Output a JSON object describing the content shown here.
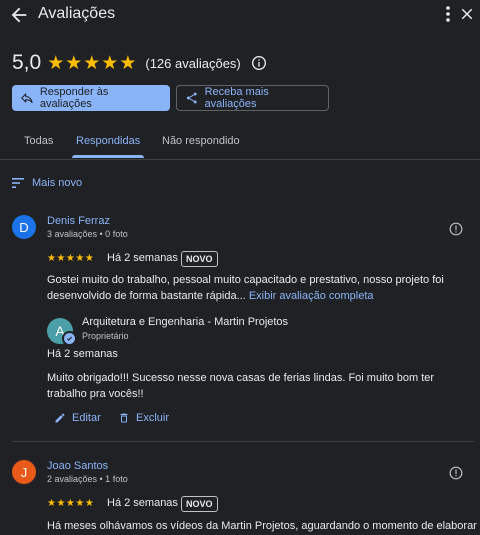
{
  "header": {
    "title": "Avaliações",
    "back_icon": "arrow-left-icon",
    "menu_icon": "more-vert-icon",
    "close_icon": "close-icon"
  },
  "summary": {
    "rating": "5,0",
    "stars": "★★★★★",
    "count": "(126 avaliações)",
    "info_icon": "info-icon",
    "star_color": "#fbbc04"
  },
  "actions": {
    "reply_label": "Responder às avaliações",
    "get_more_label": "Receba mais avaliações"
  },
  "tabs": [
    {
      "label": "Todas"
    },
    {
      "label": "Respondidas",
      "active": true
    },
    {
      "label": "Não respondido"
    }
  ],
  "sort": {
    "label": "Mais novo"
  },
  "reviews": [
    {
      "initial": "D",
      "avatar_color": "#1a73e8",
      "name": "Denis Ferraz",
      "meta": "3 avaliações • 0 foto",
      "stars": "★★★★★",
      "when": "Há 2 semanas",
      "badge": "NOVO",
      "text": "Gostei muito do trabalho, pessoal muito capacitado e prestativo, nosso projeto foi desenvolvido de forma bastante rápida...",
      "more_link": "Exibir avaliação completa",
      "reply": {
        "initial": "A",
        "owner_name": "Arquitetura e Engenharia - Martin Projetos",
        "owner_role": "Proprietário",
        "when": "Há 2 semanas",
        "text": "Muito obrigado!!! Sucesso nesse nova casas de ferias lindas. Foi muito bom ter trabalho pra vocês!!",
        "edit_label": "Editar",
        "delete_label": "Excluir"
      }
    },
    {
      "initial": "J",
      "avatar_color": "#e8591a",
      "name": "Joao Santos",
      "meta": "2 avaliações • 1 foto",
      "stars": "★★★★★",
      "when": "Há 2 semanas",
      "badge": "NOVO",
      "text": "Há meses olhávamos os vídeos da Martin Projetos, aguardando o momento de elaborar o"
    }
  ]
}
